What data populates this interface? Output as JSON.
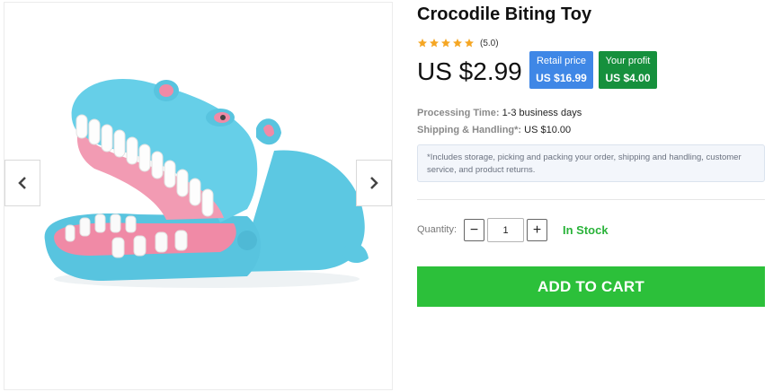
{
  "product": {
    "title": "Crocodile Biting Toy",
    "rating_value": "(5.0)",
    "rating_stars": 5,
    "price": "US $2.99",
    "image_icon": "blue-hippo-biting-toy-illustration"
  },
  "badges": {
    "retail_label": "Retail price",
    "retail_value": "US $16.99",
    "profit_label": "Your profit",
    "profit_value": "US $4.00"
  },
  "info": {
    "processing_label": "Processing Time:",
    "processing_value": "1-3 business days",
    "shipping_label": "Shipping & Handling*:",
    "shipping_value": "US $10.00",
    "note": "*Includes storage, picking and packing your order, shipping and handling, customer service, and product returns."
  },
  "purchase": {
    "quantity_label": "Quantity:",
    "minus_symbol": "−",
    "plus_symbol": "+",
    "quantity_value": "1",
    "stock_status": "In Stock",
    "add_to_cart_label": "ADD TO CART"
  },
  "gallery": {
    "prev_icon": "chevron-left-icon",
    "next_icon": "chevron-right-icon"
  },
  "colors": {
    "star": "#f5a623",
    "retail_badge": "#3f87e6",
    "profit_badge": "#16903d",
    "in_stock": "#2ab33a",
    "add_to_cart": "#2cc03a",
    "hippo_body": "#62cde6",
    "mouth": "#f18aa7"
  }
}
